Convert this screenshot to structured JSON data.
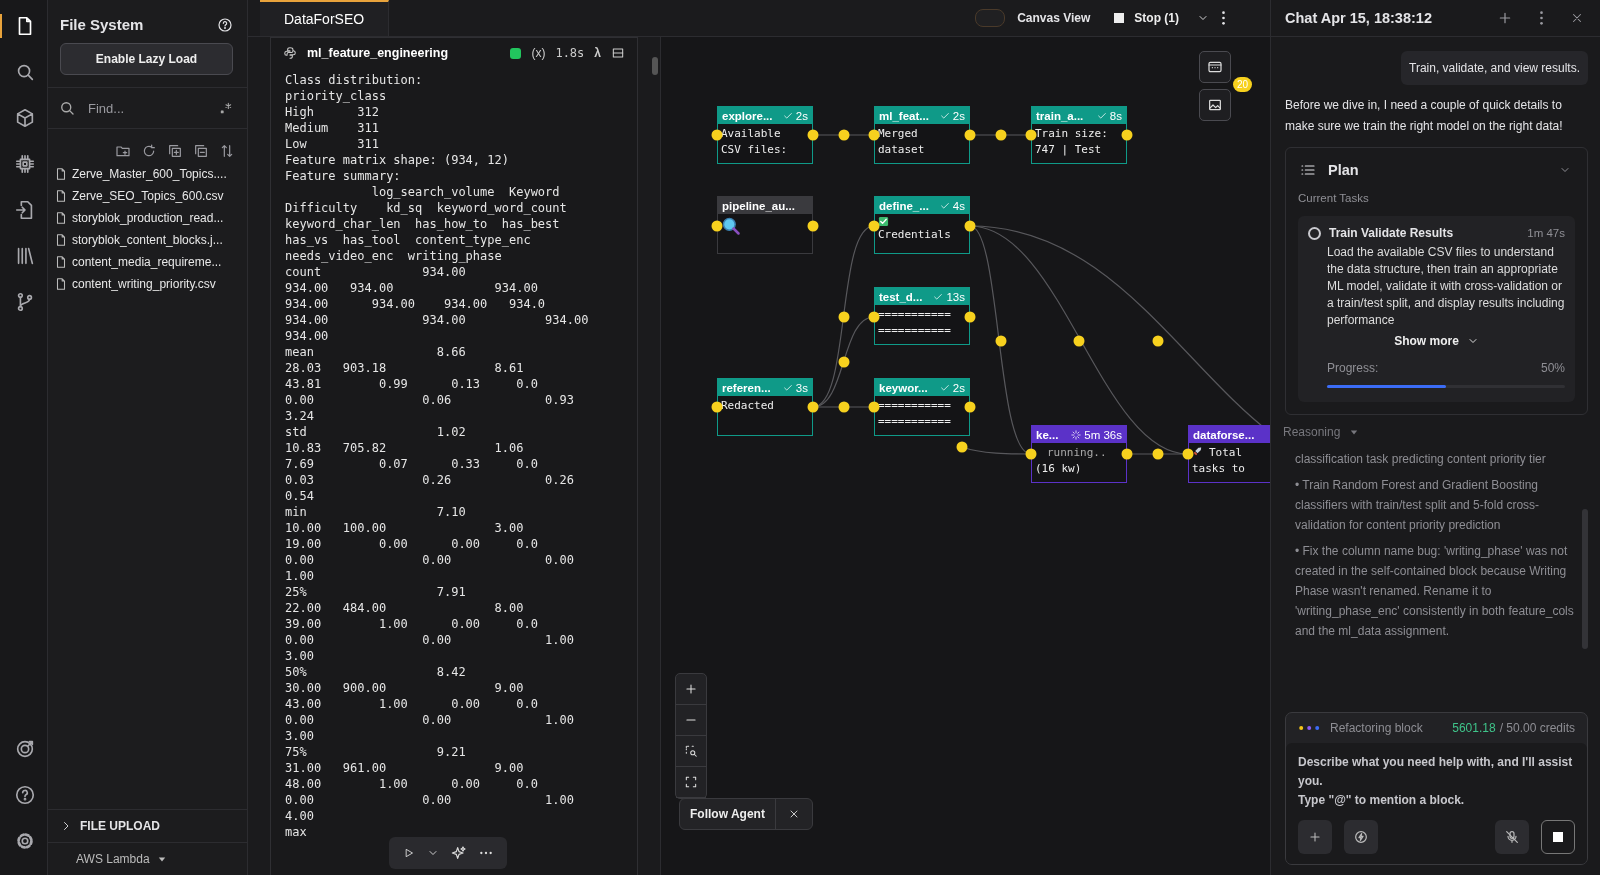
{
  "rail": {
    "items": [
      {
        "kind": "file",
        "selected": true
      },
      {
        "kind": "search",
        "selected": false
      },
      {
        "kind": "cube",
        "selected": false
      },
      {
        "kind": "chip",
        "selected": false
      },
      {
        "kind": "import",
        "selected": false
      },
      {
        "kind": "library",
        "selected": false
      },
      {
        "kind": "branch",
        "selected": false
      }
    ],
    "bottom_items": [
      {
        "kind": "target"
      },
      {
        "kind": "help"
      },
      {
        "kind": "settings"
      }
    ]
  },
  "sidebar": {
    "title": "File System",
    "lazy_load_button": "Enable Lazy Load",
    "search": {
      "placeholder": "Find..."
    },
    "files": [
      "Zerve_Master_600_Topics....",
      "Zerve_SEO_Topics_600.csv",
      "storyblok_production_read...",
      "storyblok_content_blocks.j...",
      "content_media_requireme...",
      "content_writing_priority.csv"
    ],
    "upload_section": "FILE UPLOAD",
    "runtime": "AWS Lambda"
  },
  "tabs": [
    {
      "label": "DataForSEO",
      "selected": true
    }
  ],
  "toolbar": {
    "canvas_view": {
      "label": "Canvas View",
      "on": false
    },
    "stop_button": "Stop (1)"
  },
  "code_block": {
    "name": "ml_feature_engineering",
    "succeeded": true,
    "variables": "(x)",
    "duration": "1.8s",
    "lambda": "λ",
    "output": [
      "Class distribution:",
      "priority_class",
      "High      312",
      "Medium    311",
      "Low       311",
      "Feature matrix shape: (934, 12)",
      "Feature summary:",
      "            log_search_volume  Keyword",
      "Difficulty    kd_sq  keyword_word_count",
      "keyword_char_len  has_how_to  has_best",
      "has_vs  has_tool  content_type_enc",
      "needs_video_enc  writing_phase",
      "count              934.00",
      "934.00   934.00              934.00",
      "934.00      934.00    934.00   934.0",
      "934.00             934.00           934.00",
      "934.00",
      "mean                 8.66",
      "28.03   903.18               8.61",
      "43.81        0.99      0.13     0.0",
      "0.00               0.06             0.93",
      "3.24",
      "std                  1.02",
      "10.83   705.82               1.06",
      "7.69         0.07      0.33     0.0",
      "0.03               0.26             0.26",
      "0.54",
      "min                  7.10",
      "10.00   100.00               3.00",
      "19.00        0.00      0.00     0.0",
      "0.00               0.00             0.00",
      "1.00",
      "25%                  7.91",
      "22.00   484.00               8.00",
      "39.00        1.00      0.00     0.0",
      "0.00               0.00             1.00",
      "3.00",
      "50%                  8.42",
      "30.00   900.00               9.00",
      "43.00        1.00      0.00     0.0",
      "0.00               0.00             1.00",
      "3.00",
      "75%                  9.21",
      "31.00   961.00               9.00",
      "48.00        1.00      0.00     0.0",
      "0.00               0.00             1.00",
      "4.00",
      "max"
    ]
  },
  "canvas": {
    "nodes": [
      {
        "kind": "text",
        "title": "explore...",
        "done": true,
        "running": false,
        "duration": "2s",
        "color": "#0f9a88",
        "lines": [
          "Available",
          "CSV files:"
        ]
      },
      {
        "kind": "text",
        "title": "ml_feat...",
        "done": true,
        "running": false,
        "duration": "2s",
        "color": "#0f9a88",
        "lines": [
          "Merged",
          "dataset"
        ]
      },
      {
        "kind": "text",
        "title": "train_a...",
        "done": true,
        "running": false,
        "duration": "8s",
        "color": "#0f9a88",
        "lines": [
          "Train size:",
          "747 | Test"
        ]
      },
      {
        "kind": "image",
        "title": "pipeline_au...",
        "done": false,
        "running": false,
        "color": "#3a3a3e"
      },
      {
        "kind": "checklist",
        "title": "define_...",
        "done": true,
        "running": false,
        "duration": "4s",
        "color": "#0f9a88",
        "lines": [
          "Credentials"
        ]
      },
      {
        "kind": "text",
        "title": "test_d...",
        "done": true,
        "running": false,
        "duration": "13s",
        "color": "#0f9a88",
        "lines": [
          "===========",
          "==========="
        ]
      },
      {
        "kind": "text",
        "title": "referen...",
        "done": true,
        "running": false,
        "duration": "3s",
        "color": "#0f9a88",
        "lines": [
          "Redacted"
        ]
      },
      {
        "kind": "text",
        "title": "keywor...",
        "done": true,
        "running": false,
        "duration": "2s",
        "color": "#0f9a88",
        "lines": [
          "===========",
          "==========="
        ]
      },
      {
        "kind": "text",
        "title": "ke...",
        "done": false,
        "running": true,
        "duration": "5m 36s",
        "color": "#5b32c8",
        "lines": [
          "running..",
          "(16 kw)"
        ]
      },
      {
        "kind": "launch",
        "title": "dataforse...",
        "done": false,
        "running": false,
        "color": "#5b32c8",
        "lines": [
          "Total",
          "tasks to"
        ]
      }
    ],
    "notification_count": "20",
    "follow_agent": "Follow Agent"
  },
  "chat": {
    "title": "Chat Apr 15, 18:38:12",
    "user_message": "Train, validate, and view results.",
    "assistant_message": "Before we dive in, I need a couple of quick details to make sure we train the right model on the right data!",
    "plan": {
      "title": "Plan",
      "section": "Current Tasks",
      "task": {
        "title": "Train Validate Results",
        "time": "1m 47s",
        "done": false,
        "description": "Load the available CSV files to understand the data structure, then train an appropriate ML model, validate it with cross-validation or a train/test split, and display results including performance"
      },
      "show_more": "Show more",
      "progress_label": "Progress:",
      "progress_text": "50%",
      "level": 0.5
    },
    "reasoning": {
      "label": "Reasoning",
      "items": [
        "classification task predicting content priority tier",
        "• Train Random Forest and Gradient Boosting classifiers with train/test split and 5-fold cross-validation for content priority prediction",
        "• Fix the column name bug: 'writing_phase' was not created in the self-contained block because Writing Phase wasn't renamed. Rename it to 'writing_phase_enc' consistently in both feature_cols and the ml_data assignment."
      ]
    },
    "composer": {
      "status": "Refactoring block",
      "credits_used": "5601.18",
      "credits_total": "/ 50.00 credits",
      "placeholder": "Describe what you need help with, and I'll assist you.\nType \"@\" to mention a block."
    }
  }
}
